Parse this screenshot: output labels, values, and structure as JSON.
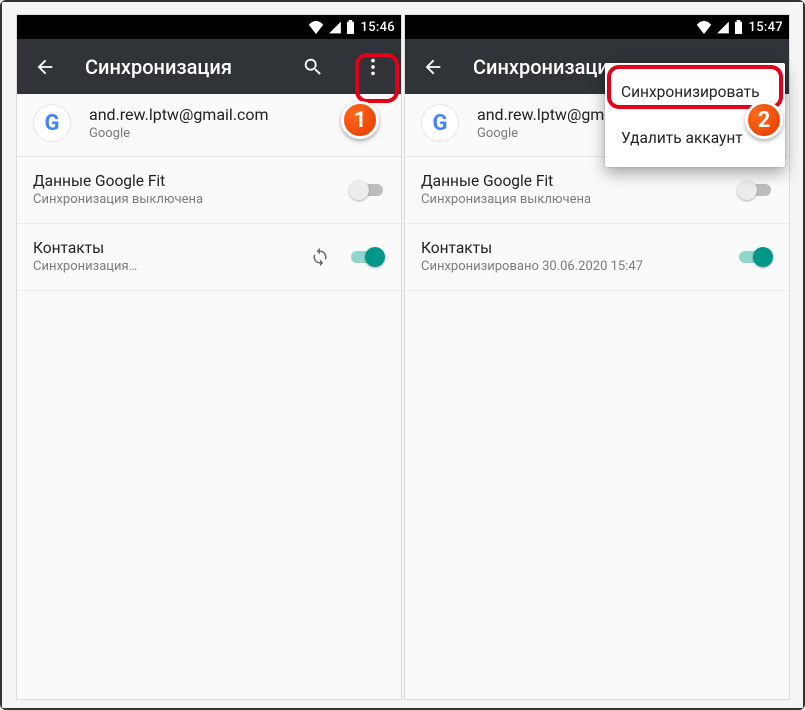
{
  "left": {
    "status_time": "15:46",
    "toolbar_title": "Синхронизация",
    "account": {
      "email": "and.rew.lptw@gmail.com",
      "provider": "Google"
    },
    "items": [
      {
        "title": "Данные Google Fit",
        "subtitle": "Синхронизация выключена",
        "on": false,
        "syncing": false
      },
      {
        "title": "Контакты",
        "subtitle": "Синхронизация…",
        "on": true,
        "syncing": true
      }
    ],
    "badge": "1"
  },
  "right": {
    "status_time": "15:47",
    "toolbar_title": "Синхронизаци",
    "account": {
      "email": "and.rew.lptw@gmail.com",
      "provider": "Google"
    },
    "items": [
      {
        "title": "Данные Google Fit",
        "subtitle": "Синхронизация выключена",
        "on": false,
        "syncing": false
      },
      {
        "title": "Контакты",
        "subtitle": "Синхронизировано 30.06.2020 15:47",
        "on": true,
        "syncing": false
      }
    ],
    "menu": {
      "sync": "Синхронизировать",
      "delete": "Удалить аккаунт"
    },
    "badge": "2"
  }
}
